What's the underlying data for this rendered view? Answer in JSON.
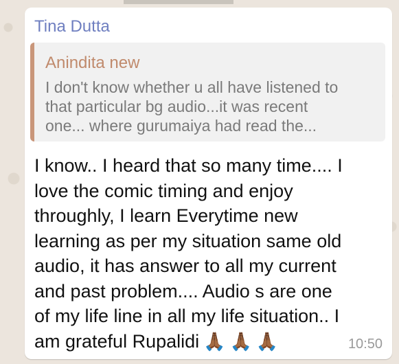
{
  "chat": {
    "sender_name": "Tina Dutta",
    "quoted": {
      "author": "Anindita new",
      "lines": [
        "I don't know whether u all have listened to",
        "that particular bg audio...it was recent",
        "one... where gurumaiya had read the..."
      ]
    },
    "message_lines": [
      "I know.. I heard that so many time.... I",
      "love the comic timing and enjoy",
      "throughly, I learn Everytime new",
      "learning as per my situation same old",
      "audio, it has answer to all my current",
      "and past problem.... Audio s are one",
      "of my life line in all my life situation.. I",
      "am grateful Rupalidi"
    ],
    "emojis": [
      "🙏🏾",
      "🙏🏾",
      "🙏🏾"
    ],
    "time": "10:50"
  },
  "colors": {
    "sender_name": "#6f7fc0",
    "quote_author": "#c08a6c",
    "quote_bar": "#c9967a",
    "bubble": "#ffffff"
  }
}
